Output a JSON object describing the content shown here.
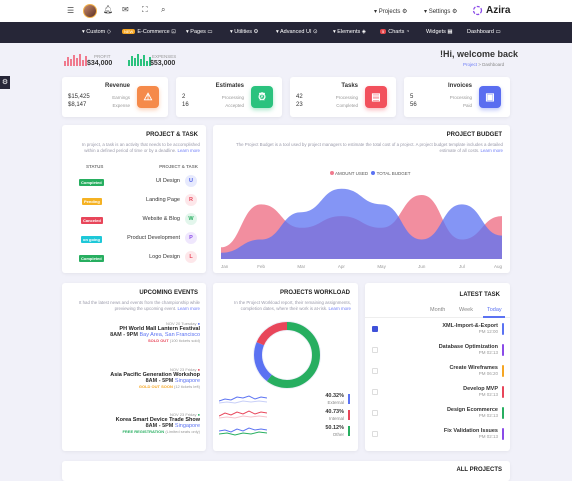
{
  "topbar": {
    "projects": "Projects",
    "settings": "Settings",
    "brand": "Azira"
  },
  "nav": {
    "custom": "Custom",
    "ecommerce_pill": "NEW",
    "ecommerce": "E-Commerce",
    "pages": "Pages",
    "utilities": "Utilities",
    "advanced": "Advanced UI",
    "elements": "Elements",
    "charts_pill": "5",
    "charts": "Charts",
    "widgets": "Widgets",
    "dashboard": "Dashboard"
  },
  "kpis": {
    "profit_label": "PROFIT",
    "profit_value": "$34,000",
    "expenses_label": "EXPENSES",
    "expenses_value": "$53,000"
  },
  "welcome": {
    "title": "!Hi, welcome back",
    "crumb_link": "Project",
    "crumb_sep": " > ",
    "crumb_current": "Dashboard"
  },
  "stats": [
    {
      "title": "Revenue",
      "v1": "$15,425",
      "l1": "Earnings",
      "v2": "$8,147",
      "l2": "Expense",
      "color": "#f58a4a"
    },
    {
      "title": "Estimates",
      "v1": "2",
      "l1": "Processing",
      "v2": "16",
      "l2": "Accepted",
      "color": "#2bc27e"
    },
    {
      "title": "Tasks",
      "v1": "42",
      "l1": "Processing",
      "v2": "23",
      "l2": "Completed",
      "color": "#f2505c"
    },
    {
      "title": "Invoices",
      "v1": "5",
      "l1": "Processing",
      "v2": "56",
      "l2": "Paid",
      "color": "#5a6df0"
    }
  ],
  "project_task": {
    "title": "PROJECT & TASK",
    "desc": "In project, a task is an activity that needs to be accomplished within a defined period of time or by a deadline.",
    "learn": "Learn more",
    "col_status": "STATUS",
    "col_task": "PROJECT & TASK",
    "rows": [
      {
        "status": "Completed",
        "name": "UI Design",
        "letter": "U",
        "scolor": "#27ae60",
        "lbg": "#e7eafd",
        "lc": "#4b5ce8"
      },
      {
        "status": "Pending",
        "name": "Landing Page",
        "letter": "R",
        "scolor": "#f5b223",
        "lbg": "#fde7ea",
        "lc": "#e8465a"
      },
      {
        "status": "Canceled",
        "name": "Website & Blog",
        "letter": "W",
        "scolor": "#e8465a",
        "lbg": "#e3f6ec",
        "lc": "#27ae60"
      },
      {
        "status": "on going",
        "name": "Product Development",
        "letter": "P",
        "scolor": "#1ec8d8",
        "lbg": "#efe7fd",
        "lc": "#8a4be8"
      },
      {
        "status": "Completed",
        "name": "Logo Design",
        "letter": "L",
        "scolor": "#27ae60",
        "lbg": "#fde7ea",
        "lc": "#e8465a"
      }
    ]
  },
  "budget": {
    "title": "PROJECT BUDGET",
    "desc": "The Project Budget is a tool used by project managers to estimate the total cost of a project. A project budget template includes a detailed estimate of all costs.",
    "learn": "Learn more"
  },
  "chart_data": {
    "type": "area",
    "categories": [
      "Jan",
      "Feb",
      "Mar",
      "Apr",
      "May",
      "Jun",
      "Jul",
      "Aug"
    ],
    "series": [
      {
        "name": "AMOUNT USED",
        "color": "#f07a8e",
        "values": [
          15,
          70,
          40,
          55,
          40,
          82,
          25,
          55
        ]
      },
      {
        "name": "TOTAL BUDGET",
        "color": "#5b72f2",
        "values": [
          8,
          25,
          60,
          90,
          70,
          25,
          70,
          30
        ]
      }
    ],
    "ylim": [
      0,
      100
    ]
  },
  "events": {
    "title": "UPCOMING EVENTS",
    "desc": "It had the latest news and events from the championship while previewing the upcoming event.",
    "learn": "Learn more",
    "items": [
      {
        "date": "NOV 20 Tuesday",
        "title": "PH World Mall Lantern Festival",
        "time": "8AM - 9PM",
        "place": "Bay Area, San Francisco",
        "status": "SOLD OUT",
        "status_extra": "(100 tickets sold)",
        "color": "#e8465a"
      },
      {
        "date": "NOV 23 Friday",
        "title": "Asia Pacific Generation Workshop",
        "time": "8AM - 5PM",
        "place": "Singapore",
        "status": "GOLD OUT SOON",
        "status_extra": "(12 tickets left)",
        "color": "#f5a623"
      },
      {
        "date": "NOV 23 Friday",
        "title": "Korea Smart Device Trade Show",
        "time": "8AM - 5PM",
        "place": "Singapore",
        "status": "FREE REGISTRATION",
        "status_extra": "(Limited seats only)",
        "color": "#27ae60"
      }
    ]
  },
  "workload": {
    "title": "PROJECTS WORKLOAD",
    "desc": "In the Project Workload report, their remaining assignments, completion dates, where their work is at-risk.",
    "learn": "Learn more",
    "items": [
      {
        "pct": "40.32%",
        "label": "External",
        "color": "#5b72f2"
      },
      {
        "pct": "40.73%",
        "label": "Internal",
        "color": "#e8465a"
      },
      {
        "pct": "50.12%",
        "label": "Other",
        "color": "#27ae60"
      }
    ]
  },
  "latest": {
    "title": "LATEST TASK",
    "tabs": [
      "Month",
      "Week",
      "Today"
    ],
    "items": [
      {
        "name": "XML-Import-&-Export",
        "time": "PM 12:00",
        "color": "#5b72f2",
        "done": true
      },
      {
        "name": "Database Optimization",
        "time": "PM 02:13",
        "color": "#8a4be8",
        "done": false
      },
      {
        "name": "Create Wireframes",
        "time": "PM 06:20",
        "color": "#f5a623",
        "done": false
      },
      {
        "name": "Develop MVP",
        "time": "PM 02:13",
        "color": "#e8465a",
        "done": false
      },
      {
        "name": "Design Ecommerce",
        "time": "PM 02:13",
        "color": "#27ae60",
        "done": false
      },
      {
        "name": "Fix Validation Issues",
        "time": "PM 02:13",
        "color": "#8a4be8",
        "done": false
      }
    ]
  },
  "all_projects": {
    "title": "ALL PROJECTS"
  }
}
